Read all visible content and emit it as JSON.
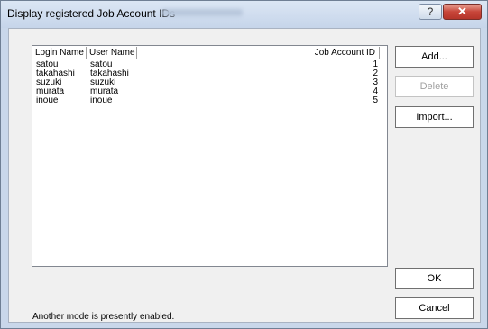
{
  "window": {
    "title": "Display registered Job Account IDs",
    "help_label": "?",
    "close_label": "✕"
  },
  "list": {
    "columns": [
      "Login Name",
      "User Name",
      "Job Account ID"
    ],
    "rows": [
      {
        "login": "satou",
        "user": "satou",
        "id": "1"
      },
      {
        "login": "takahashi",
        "user": "takahashi",
        "id": "2"
      },
      {
        "login": "suzuki",
        "user": "suzuki",
        "id": "3"
      },
      {
        "login": "murata",
        "user": "murata",
        "id": "4"
      },
      {
        "login": "inoue",
        "user": "inoue",
        "id": "5"
      }
    ]
  },
  "buttons": {
    "add": "Add...",
    "delete": "Delete",
    "import": "Import...",
    "ok": "OK",
    "cancel": "Cancel"
  },
  "status": "Another mode is presently enabled."
}
